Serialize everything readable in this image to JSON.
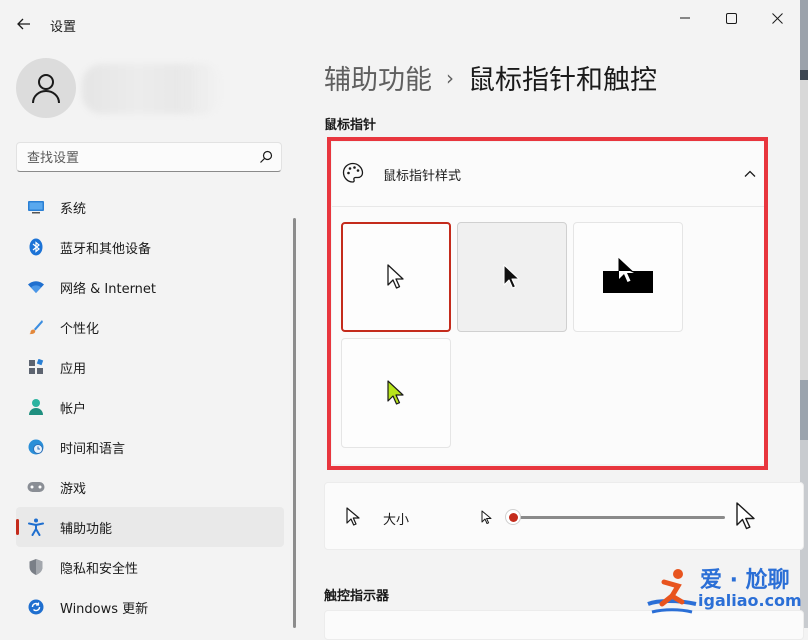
{
  "window": {
    "title": "设置",
    "back_icon": "arrow-left-icon",
    "controls": [
      "minimize-icon",
      "maximize-icon",
      "close-icon"
    ]
  },
  "search": {
    "placeholder": "查找设置",
    "icon": "search-icon"
  },
  "sidebar": {
    "items": [
      {
        "label": "系统",
        "icon": "monitor-icon",
        "color": "#2a7fd4"
      },
      {
        "label": "蓝牙和其他设备",
        "icon": "bluetooth-icon",
        "color": "#1c73d6"
      },
      {
        "label": "网络 & Internet",
        "icon": "wifi-icon",
        "color": "#1f6fcf"
      },
      {
        "label": "个性化",
        "icon": "brush-icon",
        "color": "#e3883b"
      },
      {
        "label": "应用",
        "icon": "apps-icon",
        "color": "#5d6470"
      },
      {
        "label": "帐户",
        "icon": "person-icon",
        "color": "#2bb3a0"
      },
      {
        "label": "时间和语言",
        "icon": "clock-globe-icon",
        "color": "#2a8fd8"
      },
      {
        "label": "游戏",
        "icon": "gamepad-icon",
        "color": "#6b6f76"
      },
      {
        "label": "辅助功能",
        "icon": "accessibility-icon",
        "color": "#1f6fcf",
        "active": true
      },
      {
        "label": "隐私和安全性",
        "icon": "shield-icon",
        "color": "#6e737b"
      },
      {
        "label": "Windows 更新",
        "icon": "update-icon",
        "color": "#1f6fcf"
      }
    ],
    "accent": "#c42b1c"
  },
  "breadcrumb": {
    "parent": "辅助功能",
    "separator": "›",
    "current": "鼠标指针和触控"
  },
  "sections": {
    "mouse_pointer": "鼠标指针",
    "touch_indicator": "触控指示器"
  },
  "pointer_style": {
    "title": "鼠标指针样式",
    "icon": "palette-icon",
    "expanded": true,
    "options": [
      {
        "name": "white",
        "selected": true
      },
      {
        "name": "black",
        "selected": false
      },
      {
        "name": "inverted",
        "selected": false
      },
      {
        "name": "custom",
        "selected": false,
        "color": "#b7e51b"
      }
    ]
  },
  "size": {
    "label": "大小",
    "value": 1,
    "min": 1,
    "max": 15
  },
  "watermark": {
    "top": "爱 · 尬聊",
    "bottom": "igaliao.com"
  },
  "colors": {
    "highlight_box": "#e8363e",
    "accent": "#c42b1c"
  }
}
